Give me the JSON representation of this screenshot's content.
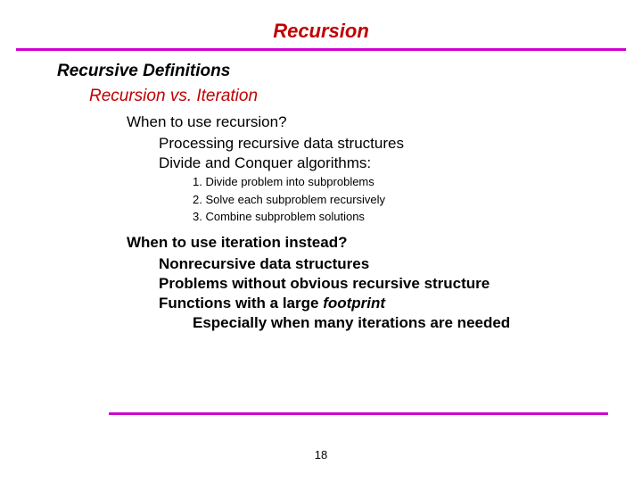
{
  "title": "Recursion",
  "section": "Recursive Definitions",
  "subsection": "Recursion vs. Iteration",
  "block1": {
    "heading": "When to use recursion?",
    "items": [
      "Processing recursive data structures",
      "Divide and Conquer algorithms:"
    ],
    "steps": [
      "1. Divide problem into subproblems",
      "2. Solve each subproblem recursively",
      "3. Combine subproblem solutions"
    ]
  },
  "block2": {
    "heading": "When to use iteration instead?",
    "items": [
      "Nonrecursive data structures",
      "Problems without obvious recursive structure"
    ],
    "footprint_prefix": "Functions with a large ",
    "footprint_word": "footprint",
    "subnote": "Especially when many iterations are needed"
  },
  "page_number": "18"
}
